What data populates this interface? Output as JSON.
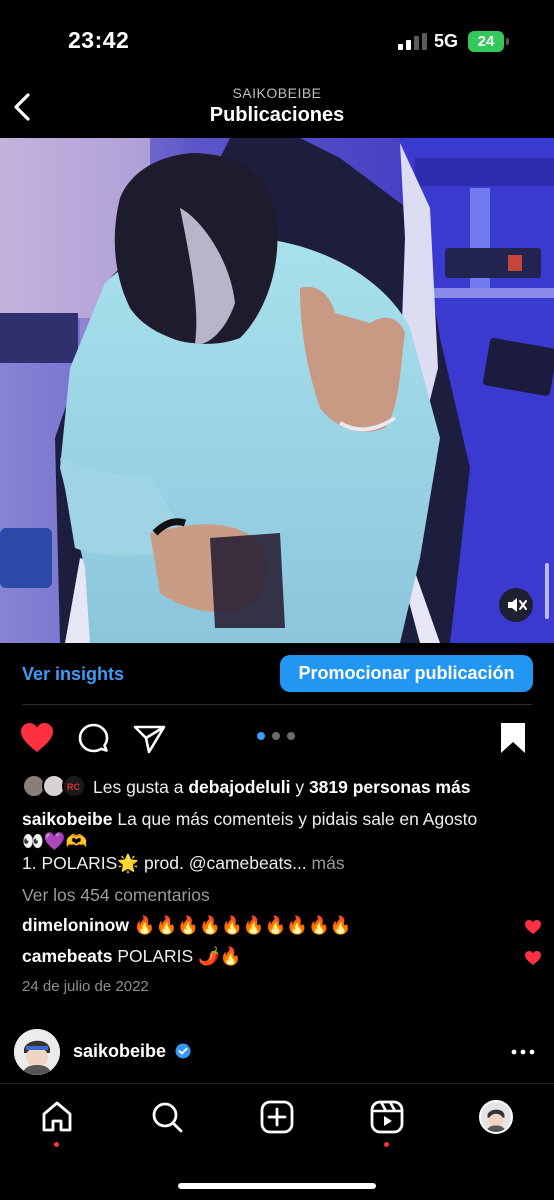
{
  "status_bar": {
    "time": "23:42",
    "network": "5G",
    "battery": "24"
  },
  "header": {
    "username": "SAIKOBEIBE",
    "title": "Publicaciones"
  },
  "post": {
    "insights_label": "Ver insights",
    "promote_label": "Promocionar publicación",
    "likes": {
      "prefix": "Les gusta a ",
      "first_user": "debajodeluli",
      "connector": " y ",
      "others": "3819 personas más"
    },
    "caption": {
      "user": "saikobeibe",
      "line1": " La que más comenteis y pidais sale en Agosto",
      "line2": "👀💜🫶",
      "line3": "1. POLARIS🌟 prod. @camebeats...",
      "more": " más"
    },
    "view_comments": "Ver los 454 comentarios",
    "comments": [
      {
        "user": "dimeloninow",
        "text": " 🔥🔥🔥🔥🔥🔥🔥🔥🔥🔥"
      },
      {
        "user": "camebeats",
        "text": " POLARIS 🌶️🔥"
      }
    ],
    "date": "24 de julio de 2022",
    "carousel": {
      "current": 1,
      "total": 3
    }
  },
  "next_post": {
    "username": "saikobeibe"
  },
  "colors": {
    "accent": "#2196f3",
    "link": "#3e9cf5",
    "like": "#ff3040",
    "battery": "#34c759"
  },
  "icons": {
    "back": "chevron-left-icon",
    "mute": "speaker-muted-icon",
    "like": "heart-filled-icon",
    "comment": "speech-bubble-icon",
    "share": "paper-plane-icon",
    "save": "bookmark-filled-icon",
    "verified": "verified-badge-icon",
    "more": "ellipsis-icon",
    "tabs": [
      "home-icon",
      "search-icon",
      "create-icon",
      "reels-icon",
      "profile-avatar"
    ]
  }
}
